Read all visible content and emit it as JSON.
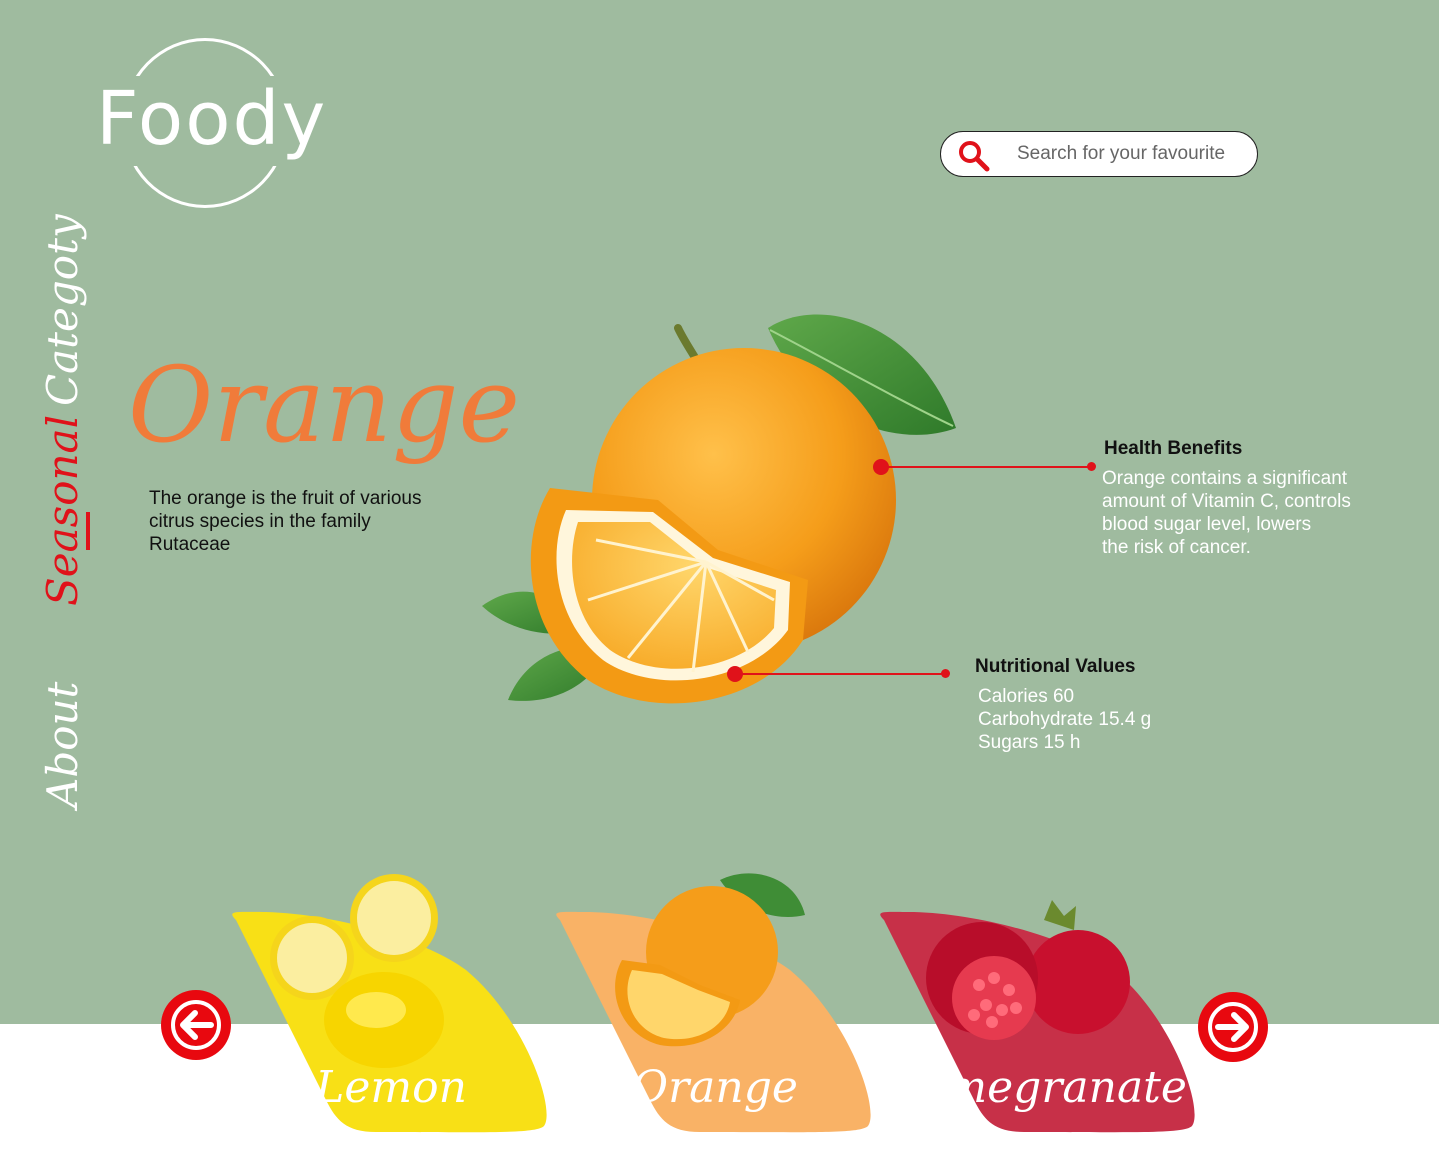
{
  "brand": {
    "logo_text": "Foody"
  },
  "search": {
    "placeholder": "Search for your favourite"
  },
  "nav": {
    "items": [
      {
        "label": "Categoty",
        "active": false
      },
      {
        "label": "Seasonal",
        "active": true
      },
      {
        "label": "About",
        "active": false
      }
    ]
  },
  "fruit": {
    "name": "Orange",
    "description": "The orange is the fruit of various citrus species in the family Rutaceae"
  },
  "health": {
    "title": "Health Benefits",
    "lines": [
      "Orange contains a significant",
      "amount of Vitamin C, controls",
      "blood sugar level, lowers",
      "the risk of cancer."
    ]
  },
  "nutrition": {
    "title": "Nutritional Values",
    "lines": [
      "Calories 60",
      "Carbohydrate 15.4 g",
      "Sugars 15 h"
    ]
  },
  "carousel": {
    "items": [
      {
        "label": "Lemon",
        "color": "#f8e016"
      },
      {
        "label": "Orange",
        "color": "#f9b266"
      },
      {
        "label": "Pomegranate",
        "color": "#c73048"
      }
    ]
  },
  "colors": {
    "background": "#9fbb9f",
    "accent_red": "#e0121a",
    "title_orange": "#f07b3a"
  }
}
